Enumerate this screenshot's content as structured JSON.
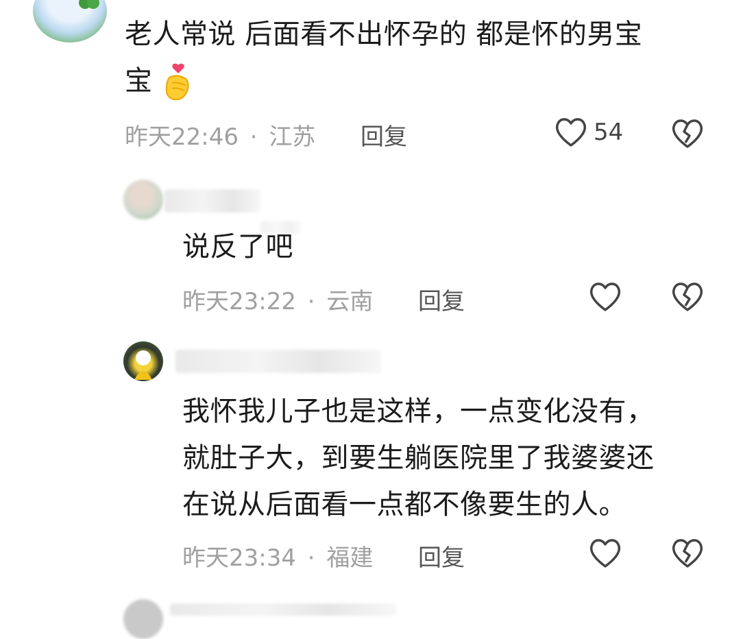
{
  "comments": [
    {
      "text_line1": "老人常说 后面看不出怀孕的  都是怀的男宝",
      "text_line2": "宝",
      "emoji_icon": "finger-heart-icon",
      "time": "昨天22:46",
      "separator": "·",
      "location": "江苏",
      "reply_label": "回复",
      "like_count": "54"
    },
    {
      "text": "说反了吧",
      "time": "昨天23:22",
      "separator": "·",
      "location": "云南",
      "reply_label": "回复"
    },
    {
      "text_line1": "我怀我儿子也是这样，一点变化没有，",
      "text_line2": "就肚子大，到要生躺医院里了我婆婆还",
      "text_line3": "在说从后面看一点都不像要生的人。",
      "time": "昨天23:34",
      "separator": "·",
      "location": "福建",
      "reply_label": "回复"
    }
  ],
  "icons": {
    "like": "heart-outline-icon",
    "dislike": "broken-heart-icon"
  }
}
